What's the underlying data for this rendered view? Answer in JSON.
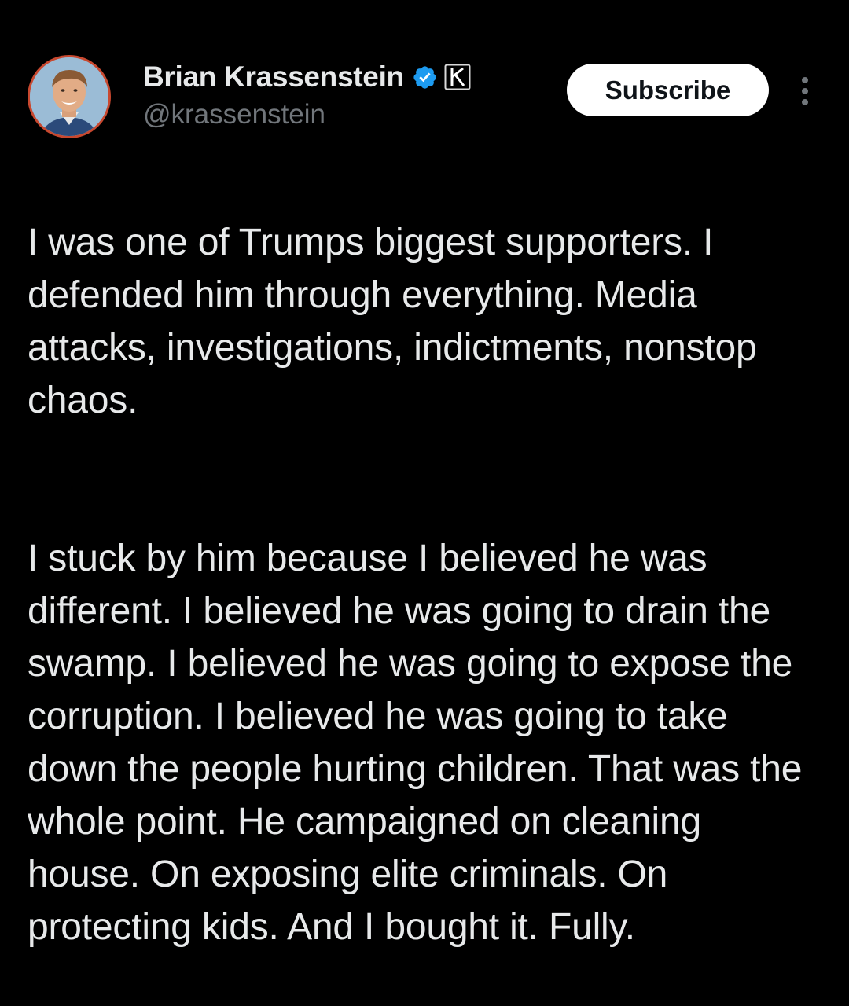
{
  "author": {
    "display_name": "Brian Krassenstein",
    "handle": "@krassenstein",
    "verified_icon": "verified-badge-icon",
    "affiliate_icon": "k-affiliate-badge-icon",
    "verified_color": "#1d9bf0"
  },
  "actions": {
    "subscribe_label": "Subscribe",
    "more_icon": "more-vertical-icon"
  },
  "tweet": {
    "paragraphs": [
      "I was one of Trumps biggest supporters. I defended him through everything. Media attacks, investigations, indictments, nonstop chaos.",
      "I stuck by him because I believed he was different. I believed he was going to drain the swamp. I believed he was going to expose the corruption. I believed he was going to take down the people hurting children. That was the whole point. He campaigned on cleaning house. On exposing elite criminals. On protecting kids. And I bought it. Fully."
    ]
  },
  "theme": {
    "background": "#000000",
    "text": "#e7e9ea",
    "muted": "#71767b",
    "divider": "#2f3336"
  }
}
